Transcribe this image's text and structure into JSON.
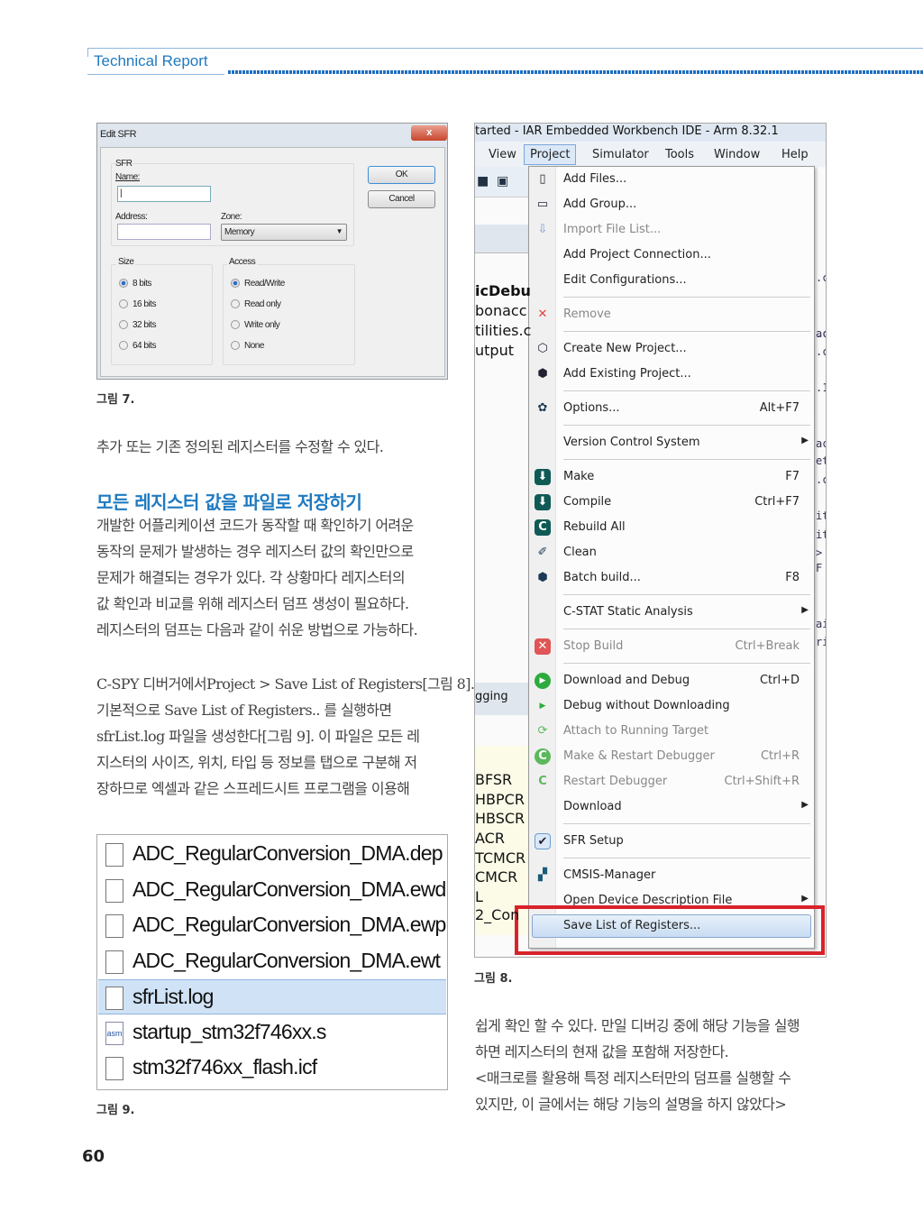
{
  "header": {
    "section_title": "Technical Report"
  },
  "figure7": {
    "caption": "그림 7.",
    "dialog": {
      "title": "Edit SFR",
      "close_label": "x",
      "sfr_group": "SFR",
      "name_label": "Name:",
      "name_value": "|",
      "address_label": "Address:",
      "address_value": "",
      "zone_label": "Zone:",
      "zone_value": "Memory",
      "ok": "OK",
      "cancel": "Cancel",
      "size_group": "Size",
      "size_options": [
        "8 bits",
        "16 bits",
        "32 bits",
        "64 bits"
      ],
      "size_selected": "8 bits",
      "access_group": "Access",
      "access_options": [
        "Read/Write",
        "Read only",
        "Write only",
        "None"
      ],
      "access_selected": "Read/Write"
    }
  },
  "intro_text": "추가 또는 기존 정의된 레지스터를 수정할 수 있다.",
  "section_heading": "모든 레지스터 값을 파일로 저장하기",
  "paragraph1": [
    "개발한 어플리케이션 코드가 동작할 때 확인하기 어려운",
    "동작의 문제가 발생하는 경우 레지스터 값의 확인만으로",
    "문제가 해결되는 경우가 있다. 각 상황마다 레지스터의",
    "값 확인과 비교를 위해 레지스터 덤프 생성이 필요하다.",
    "레지스터의 덤프는 다음과 같이 쉬운 방법으로 가능하다."
  ],
  "paragraph2": [
    "C-SPY 디버거에서Project > Save List of Registers[그림 8].",
    "기본적으로 Save List of Registers.. 를 실행하면",
    "sfrList.log 파일을 생성한다[그림 9]. 이 파일은 모든 레",
    "지스터의 사이즈, 위치, 타입 등 정보를 탭으로 구분해 저",
    "장하므로 엑셀과 같은 스프레드시트 프로그램을 이용해"
  ],
  "paragraph3": [
    "쉽게 확인 할 수 있다. 만일 디버깅 중에 해당 기능을 실행",
    "하면 레지스터의 현재 값을 포함해 저장한다.",
    "<매크로를 활용해 특정 레지스터만의 덤프를 실행할 수",
    "있지만, 이 글에서는 해당 기능의 설명을 하지 않았다>"
  ],
  "figure9": {
    "caption": "그림 9.",
    "files": [
      {
        "name": "ADC_RegularConversion_DMA.dep",
        "icon": "file-icon"
      },
      {
        "name": "ADC_RegularConversion_DMA.ewd",
        "icon": "file-icon"
      },
      {
        "name": "ADC_RegularConversion_DMA.ewp",
        "icon": "file-icon"
      },
      {
        "name": "ADC_RegularConversion_DMA.ewt",
        "icon": "file-icon"
      },
      {
        "name": "sfrList.log",
        "icon": "text-file-icon",
        "selected": true
      },
      {
        "name": "startup_stm32f746xx.s",
        "icon": "asm-file-icon",
        "icon_text": "asm"
      },
      {
        "name": "stm32f746xx_flash.icf",
        "icon": "file-icon"
      }
    ]
  },
  "figure8": {
    "caption": "그림 8.",
    "window_title": "tarted - IAR Embedded Workbench IDE - Arm 8.32.1",
    "menubar": [
      "View",
      "Project",
      "Simulator",
      "Tools",
      "Window",
      "Help"
    ],
    "active_menu": "Project",
    "left_fragments": [
      "icDebu",
      "bonacc",
      "tilities.c",
      "utput",
      "gging",
      "BFSR",
      "HBPCR",
      "HBSCR",
      "ACR",
      "TCMCR",
      "CMCR",
      "L",
      "2_Con"
    ],
    "right_fragments": [
      ".c",
      ".c",
      "ac",
      ".c",
      ".1",
      "ac",
      "et",
      ".c",
      "it",
      "it",
      ">",
      "F",
      "ai",
      "ri"
    ],
    "menu_items": [
      {
        "label": "Add Files...",
        "icon": "add-files-icon"
      },
      {
        "label": "Add Group...",
        "icon": "add-group-icon"
      },
      {
        "label": "Import File List...",
        "icon": "import-icon",
        "disabled": true
      },
      {
        "label": "Add Project Connection..."
      },
      {
        "label": "Edit Configurations..."
      },
      {
        "separator": true
      },
      {
        "label": "Remove",
        "icon": "remove-x-icon",
        "disabled": true
      },
      {
        "separator": true
      },
      {
        "label": "Create New Project...",
        "icon": "create-project-icon"
      },
      {
        "label": "Add Existing Project...",
        "icon": "add-project-icon"
      },
      {
        "separator": true
      },
      {
        "label": "Options...",
        "shortcut": "Alt+F7",
        "icon": "gear-icon"
      },
      {
        "separator": true
      },
      {
        "label": "Version Control System",
        "submenu": true
      },
      {
        "separator": true
      },
      {
        "label": "Make",
        "shortcut": "F7",
        "icon": "make-icon"
      },
      {
        "label": "Compile",
        "shortcut": "Ctrl+F7",
        "icon": "compile-icon"
      },
      {
        "label": "Rebuild All",
        "icon": "rebuild-icon"
      },
      {
        "label": "Clean",
        "icon": "eraser-icon"
      },
      {
        "label": "Batch build...",
        "shortcut": "F8",
        "icon": "batch-build-icon"
      },
      {
        "separator": true
      },
      {
        "label": "C-STAT Static Analysis",
        "submenu": true
      },
      {
        "separator": true
      },
      {
        "label": "Stop Build",
        "shortcut": "Ctrl+Break",
        "icon": "stop-icon",
        "disabled": true
      },
      {
        "separator": true
      },
      {
        "label": "Download and Debug",
        "shortcut": "Ctrl+D",
        "icon": "play-icon"
      },
      {
        "label": "Debug without Downloading",
        "icon": "play-small-icon"
      },
      {
        "label": "Attach to Running Target",
        "icon": "attach-icon",
        "disabled": true
      },
      {
        "label": "Make & Restart Debugger",
        "shortcut": "Ctrl+R",
        "icon": "restart-icon",
        "disabled": true
      },
      {
        "label": "Restart Debugger",
        "shortcut": "Ctrl+Shift+R",
        "icon": "restart-small-icon",
        "disabled": true
      },
      {
        "label": "Download",
        "submenu": true
      },
      {
        "separator": true
      },
      {
        "label": "SFR Setup",
        "icon": "check-icon"
      },
      {
        "separator": true
      },
      {
        "label": "CMSIS-Manager",
        "icon": "cmsis-icon"
      },
      {
        "label": "Open Device Description File",
        "submenu": true
      },
      {
        "label": "Save List of Registers...",
        "highlighted": true
      }
    ],
    "highlight_color": "#d8232a"
  },
  "page_number": "60",
  "colors": {
    "accent": "#1f7ac0",
    "highlight_box": "#d8232a"
  }
}
